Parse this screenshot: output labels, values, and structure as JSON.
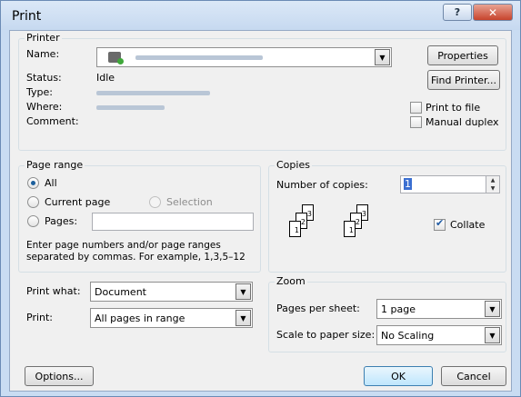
{
  "title": "Print",
  "printer": {
    "legend": "Printer",
    "name_label": "Name:",
    "status_label": "Status:",
    "status_value": "Idle",
    "type_label": "Type:",
    "where_label": "Where:",
    "comment_label": "Comment:",
    "properties_label": "Properties",
    "find_printer_label": "Find Printer...",
    "print_to_file_label": "Print to file",
    "manual_duplex_label": "Manual duplex"
  },
  "page_range": {
    "legend": "Page range",
    "all_label": "All",
    "current_page_label": "Current page",
    "selection_label": "Selection",
    "pages_label": "Pages:",
    "hint": "Enter page numbers and/or page ranges separated by commas.  For example, 1,3,5–12"
  },
  "copies": {
    "legend": "Copies",
    "number_label": "Number of copies:",
    "number_value": "1",
    "collate_label": "Collate"
  },
  "print_what": {
    "label": "Print what:",
    "value": "Document"
  },
  "print": {
    "label": "Print:",
    "value": "All pages in range"
  },
  "zoom": {
    "legend": "Zoom",
    "pages_per_sheet_label": "Pages per sheet:",
    "pages_per_sheet_value": "1 page",
    "scale_label": "Scale to paper size:",
    "scale_value": "No Scaling"
  },
  "buttons": {
    "options": "Options...",
    "ok": "OK",
    "cancel": "Cancel"
  }
}
